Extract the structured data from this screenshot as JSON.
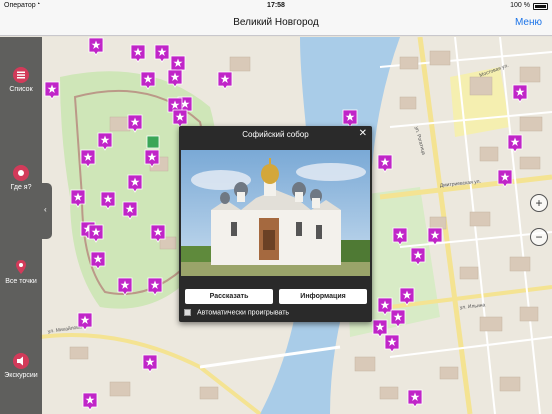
{
  "status_bar": {
    "carrier": "Оператор",
    "time": "17:58",
    "battery": "100 %"
  },
  "nav": {
    "title": "Великий Новгород",
    "menu_label": "Меню"
  },
  "sidebar": {
    "items": [
      {
        "label": "Список",
        "icon": "list-icon"
      },
      {
        "label": "Где я?",
        "icon": "locate-icon"
      },
      {
        "label": "Все точки",
        "icon": "map-pin-icon"
      },
      {
        "label": "Экскурсии",
        "icon": "audio-tour-icon"
      }
    ],
    "handle_glyph": "‹"
  },
  "popup": {
    "title": "Софийский собор",
    "close_glyph": "✕",
    "tell_label": "Рассказать",
    "info_label": "Информация",
    "autoplay_label": "Автоматически проигрывать"
  },
  "map": {
    "street_labels": [
      "ул. Ильина",
      "ул. Михайлова",
      "Мостовая ул.",
      "Дмитриевская ул.",
      "ул. Рогатица"
    ],
    "zoom_in": "+",
    "zoom_out": "−"
  },
  "colors": {
    "marker": "#c025c8",
    "water": "#a9cce8",
    "park": "#cfe6b8",
    "road_major": "#f4e392",
    "accent": "#1a73e8"
  }
}
